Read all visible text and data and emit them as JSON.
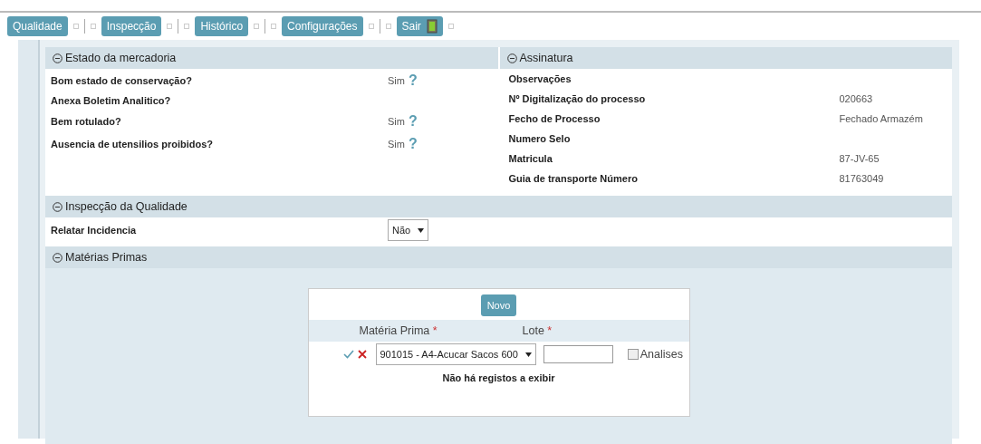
{
  "nav": [
    {
      "label": "Qualidade",
      "kind": "plain"
    },
    {
      "label": "Inspecção",
      "kind": "plain"
    },
    {
      "label": "Histórico",
      "kind": "plain"
    },
    {
      "label": "Configurações",
      "kind": "plain"
    },
    {
      "label": "Sair",
      "kind": "exit"
    }
  ],
  "estado": {
    "title": "Estado da mercadoria",
    "expanded": true,
    "rows": [
      {
        "label": "Bom estado de conservação?",
        "value": "Sim",
        "help": "?"
      },
      {
        "label": "Anexa Boletim Analitico?"
      },
      {
        "label": "Bem rotulado?",
        "value": "Sim",
        "help": "?"
      },
      {
        "label": "Ausencia de utensilios proibidos?",
        "value": "Sim",
        "help": "?"
      }
    ]
  },
  "assinatura": {
    "title": "Assinatura",
    "expanded": true,
    "rows": [
      {
        "label": "Observações"
      },
      {
        "label": "Nº Digitalização do processo",
        "value": "020663"
      },
      {
        "label": "Fecho de Processo",
        "value": "Fechado Armazém"
      },
      {
        "label": "Numero Selo"
      },
      {
        "label": "Matricula",
        "value": "87-JV-65"
      },
      {
        "label": "Guia de transporte Número",
        "value": "81763049"
      }
    ]
  },
  "inspeccao": {
    "title": "Inspecção da Qualidade",
    "expanded": true,
    "label": "Relatar Incidencia",
    "select": "Não"
  },
  "materias": {
    "title": "Matérias Primas",
    "expanded": true,
    "new_button": "Novo",
    "columns": [
      {
        "label": "Matéria Prima",
        "required_mark": "*"
      },
      {
        "label": "Lote",
        "required_mark": "*"
      }
    ],
    "row": {
      "material": "901015 - A4-Acucar Sacos 600",
      "checkbox": {
        "label": "Analises",
        "checked": false
      }
    },
    "empty_message": "Não há registos a exibir"
  }
}
